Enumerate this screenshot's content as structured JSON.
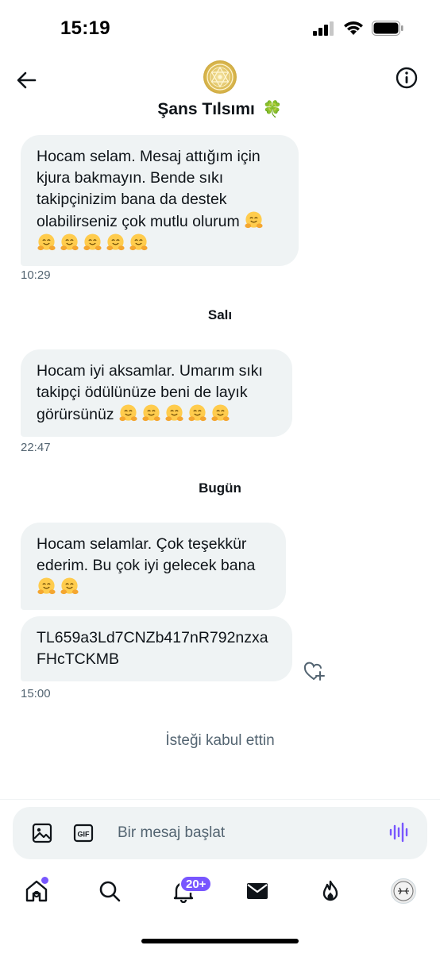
{
  "status_bar": {
    "time": "15:19"
  },
  "header": {
    "title": "Şans Tılsımı",
    "title_emoji": "🍀"
  },
  "messages": [
    {
      "text": "Hocam selam. Mesaj attığım için kjura bakmayın. Bende sıkı takipçinizim bana da destek olabilirseniz çok mutlu olurum",
      "emoji_count": 6,
      "time": "10:29"
    },
    {
      "text": "Hocam iyi aksamlar. Umarım sıkı takipçi ödülünüze beni de layık görürsünüz",
      "emoji_count": 5,
      "time": "22:47"
    },
    {
      "text": "Hocam selamlar. Çok teşekkür ederim. Bu çok iyi gelecek bana",
      "emoji_count": 2,
      "time": ""
    },
    {
      "text": "TL659a3Ld7CNZb417nR792nzxa FHcTCKMB",
      "emoji_count": 0,
      "time": "15:00"
    }
  ],
  "separators": {
    "day1": "Salı",
    "day2": "Bugün"
  },
  "notice": "İsteği kabul ettin",
  "composer": {
    "placeholder": "Bir mesaj başlat"
  },
  "tabbar": {
    "notifications_badge": "20+"
  },
  "colors": {
    "accent": "#7856ff",
    "bubble": "#eff3f4",
    "muted": "#536471"
  }
}
